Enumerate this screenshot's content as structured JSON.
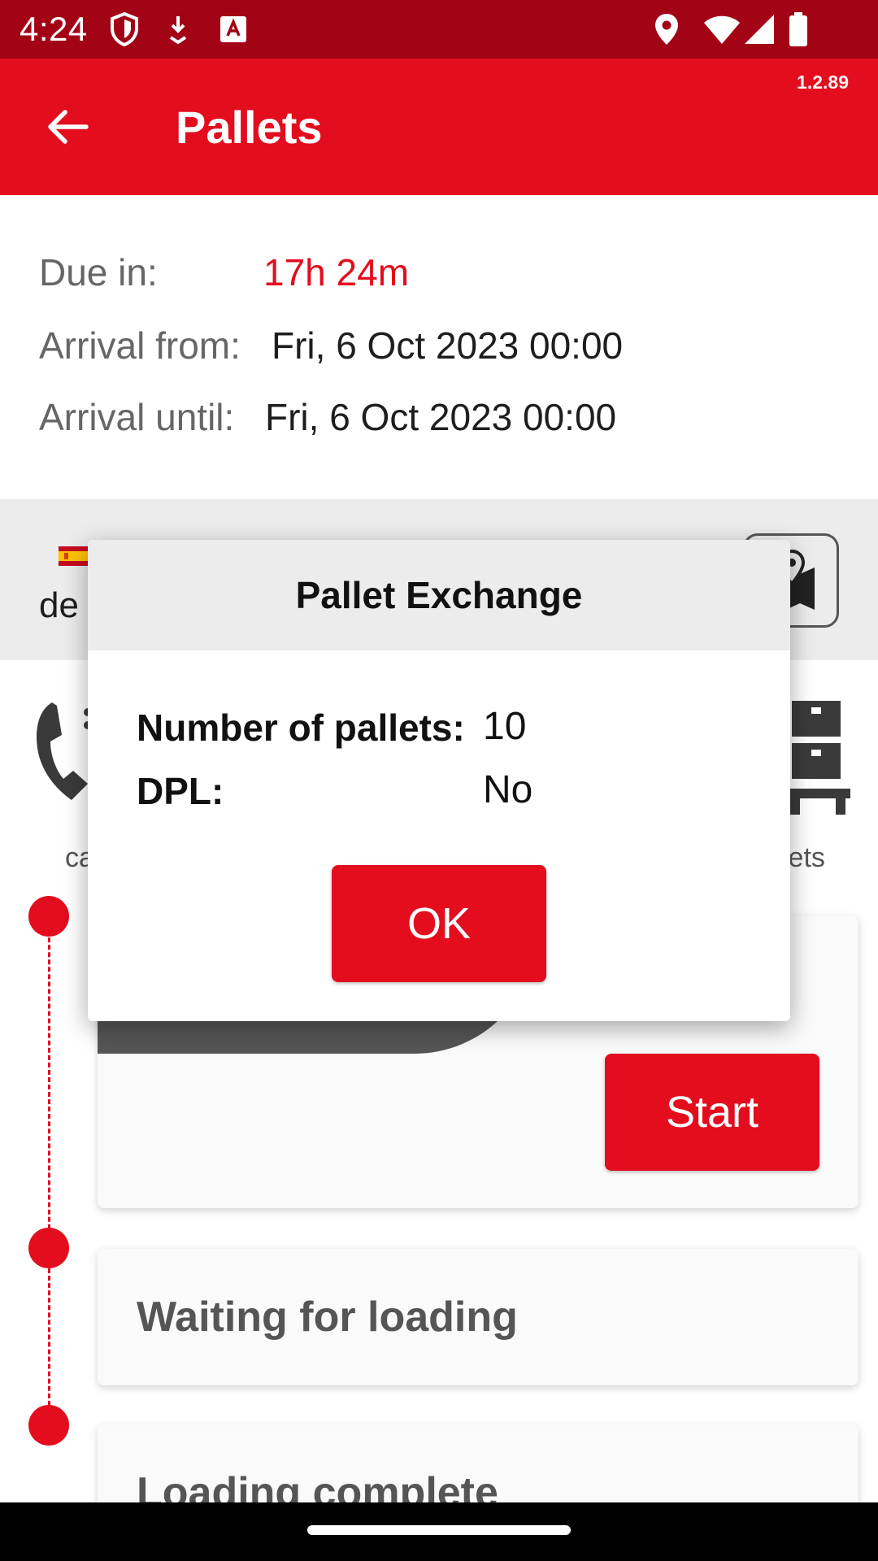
{
  "status_bar": {
    "time": "4:24",
    "icons": [
      "shield-icon",
      "download-icon",
      "font-a-icon",
      "location-icon",
      "wifi-icon",
      "signal-icon",
      "battery-icon"
    ]
  },
  "app_bar": {
    "title": "Pallets",
    "version": "1.2.89"
  },
  "info": {
    "due_label": "Due in:",
    "due_value": "17h 24m",
    "arrival_from_label": "Arrival from:",
    "arrival_from_value": "Fri, 6 Oct 2023 00:00",
    "arrival_until_label": "Arrival until:",
    "arrival_until_value": "Fri, 6 Oct 2023 00:00"
  },
  "location": {
    "text_visible": "de",
    "flag": "spain-flag-icon"
  },
  "actions": {
    "left_label_partial": "ca",
    "right_label_partial": "lets"
  },
  "cards": {
    "start_label": "Start",
    "waiting": "Waiting for loading",
    "complete": "Loading complete"
  },
  "dialog": {
    "title": "Pallet Exchange",
    "rows": [
      {
        "label": "Number of pallets:",
        "value": "10"
      },
      {
        "label": "DPL:",
        "value": "No"
      }
    ],
    "ok_label": "OK"
  },
  "colors": {
    "brand_red": "#e30d1e",
    "status_bar": "#a20416"
  }
}
